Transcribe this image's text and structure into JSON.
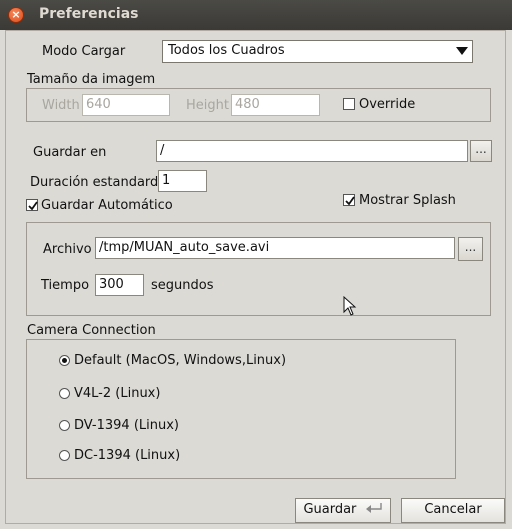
{
  "window": {
    "title": "Preferencias"
  },
  "modo_cargar": {
    "label": "Modo Cargar",
    "value": "Todos los Cuadros"
  },
  "image_size": {
    "group_label": "Tamaño da imagem",
    "width_label": "Width",
    "width_value": "640",
    "height_label": "Height",
    "height_value": "480",
    "override_label": "Override",
    "override_checked": false
  },
  "guardar_en": {
    "label": "Guardar en",
    "value": "/",
    "browse_label": "..."
  },
  "duracion": {
    "label": "Duración estandard",
    "value": "1"
  },
  "guardar_automatico": {
    "label": "Guardar Automático",
    "checked": true
  },
  "mostrar_splash": {
    "label": "Mostrar Splash",
    "checked": true
  },
  "autosave": {
    "archivo_label": "Archivo",
    "archivo_value": "/tmp/MUAN_auto_save.avi",
    "browse_label": "...",
    "tiempo_label": "Tiempo",
    "tiempo_value": "300",
    "segundos_label": "segundos"
  },
  "camera": {
    "group_label": "Camera Connection",
    "options": [
      {
        "label": "Default (MacOS, Windows,Linux)",
        "selected": true
      },
      {
        "label": "V4L-2 (Linux)",
        "selected": false
      },
      {
        "label": "DV-1394 (Linux)",
        "selected": false
      },
      {
        "label": "DC-1394 (Linux)",
        "selected": false
      }
    ]
  },
  "buttons": {
    "save_label": "Guardar",
    "cancel_label": "Cancelar"
  }
}
